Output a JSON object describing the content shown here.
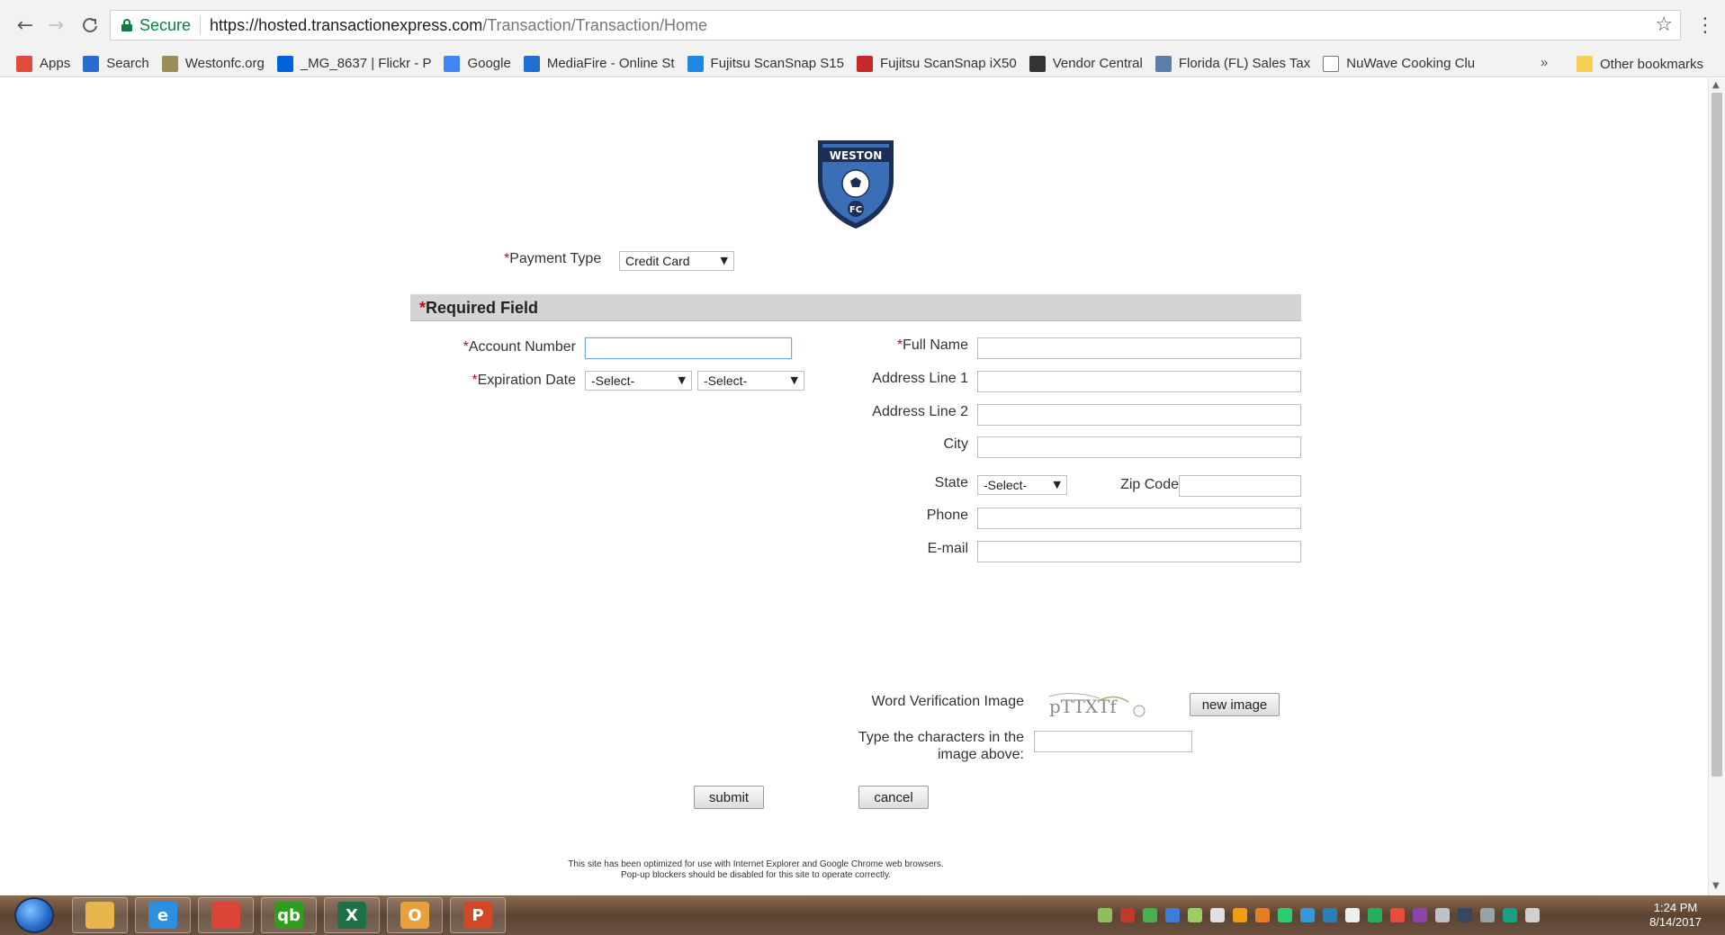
{
  "browser": {
    "nav": {
      "back": "←",
      "forward": "→",
      "reload": "C"
    },
    "address": {
      "secure_label": "Secure",
      "url_host": "https://hosted.transactionexpress.com",
      "url_path": "/Transaction/Transaction/Home"
    },
    "star": "☆",
    "menu": "⋮",
    "bookmarks": [
      {
        "label": "Apps",
        "icon": "apps-grid-icon",
        "color": "#e24b3b"
      },
      {
        "label": "Search",
        "icon": "search-bookmark-icon",
        "color": "#2a6bd1"
      },
      {
        "label": "Westonfc.org",
        "icon": "westonfc-icon",
        "color": "#9b8f55"
      },
      {
        "label": "_MG_8637 | Flickr - P",
        "icon": "flickr-icon",
        "color": "#0063dc"
      },
      {
        "label": "Google",
        "icon": "google-icon",
        "color": "#4285f4"
      },
      {
        "label": "MediaFire - Online St",
        "icon": "mediafire-icon",
        "color": "#1f6fd1"
      },
      {
        "label": "Fujitsu ScanSnap S15",
        "icon": "fujitsu-icon",
        "color": "#1e88e5"
      },
      {
        "label": "Fujitsu ScanSnap iX50",
        "icon": "fujitsu-red-icon",
        "color": "#c62828"
      },
      {
        "label": "Vendor Central",
        "icon": "amazon-icon",
        "color": "#333333"
      },
      {
        "label": "Florida (FL) Sales Tax",
        "icon": "st-icon",
        "color": "#5b7fa8"
      },
      {
        "label": "NuWave Cooking Clu",
        "icon": "page-icon",
        "color": "#ffffff"
      }
    ],
    "overflow": "»",
    "other_bookmarks": "Other bookmarks"
  },
  "form": {
    "payment_type": {
      "required_mark": "*",
      "label": "Payment Type",
      "value": "Credit Card",
      "caret": "▼"
    },
    "required_header": {
      "mark": "*",
      "text": "Required Field"
    },
    "account_number": {
      "required_mark": "*",
      "label": "Account Number",
      "value": ""
    },
    "expiration_date": {
      "required_mark": "*",
      "label": "Expiration Date",
      "month": "-Select-",
      "year": "-Select-",
      "caret": "▼"
    },
    "full_name": {
      "required_mark": "*",
      "label": "Full Name",
      "value": ""
    },
    "address_line_1": {
      "label": "Address Line 1",
      "value": ""
    },
    "address_line_2": {
      "label": "Address Line 2",
      "value": ""
    },
    "city": {
      "label": "City",
      "value": ""
    },
    "state": {
      "label": "State",
      "value": "-Select-",
      "caret": "▼"
    },
    "zip_code": {
      "label": "Zip Code",
      "value": ""
    },
    "phone": {
      "label": "Phone",
      "value": ""
    },
    "email": {
      "label": "E-mail",
      "value": ""
    },
    "verification": {
      "label": "Word Verification Image",
      "captcha_text": "pTTXTf",
      "new_image_label": "new image",
      "type_label_line1": "Type the characters in the",
      "type_label_line2": "image above:",
      "value": ""
    },
    "submit_label": "submit",
    "cancel_label": "cancel"
  },
  "footer": {
    "line1": "This site has been optimized for use with Internet Explorer and Google Chrome web browsers.",
    "line2": "Pop-up blockers should be disabled for this site to operate correctly."
  },
  "logo": {
    "top_text": "WESTON",
    "bottom_text": "FC",
    "color": "#3a6fb7"
  },
  "taskbar": {
    "apps": [
      {
        "name": "file-explorer-icon",
        "glyph": "",
        "color": "#e8b64a"
      },
      {
        "name": "internet-explorer-icon",
        "glyph": "e",
        "color": "#2d8fe0"
      },
      {
        "name": "chrome-icon",
        "glyph": "",
        "color": "#db4437"
      },
      {
        "name": "quickbooks-icon",
        "glyph": "qb",
        "color": "#2ca01c"
      },
      {
        "name": "excel-icon",
        "glyph": "X",
        "color": "#1e7145"
      },
      {
        "name": "outlook-icon",
        "glyph": "O",
        "color": "#e8a13a"
      },
      {
        "name": "powerpoint-icon",
        "glyph": "P",
        "color": "#d24726"
      }
    ],
    "clock": {
      "time": "1:24 PM",
      "date": "8/14/2017"
    }
  }
}
